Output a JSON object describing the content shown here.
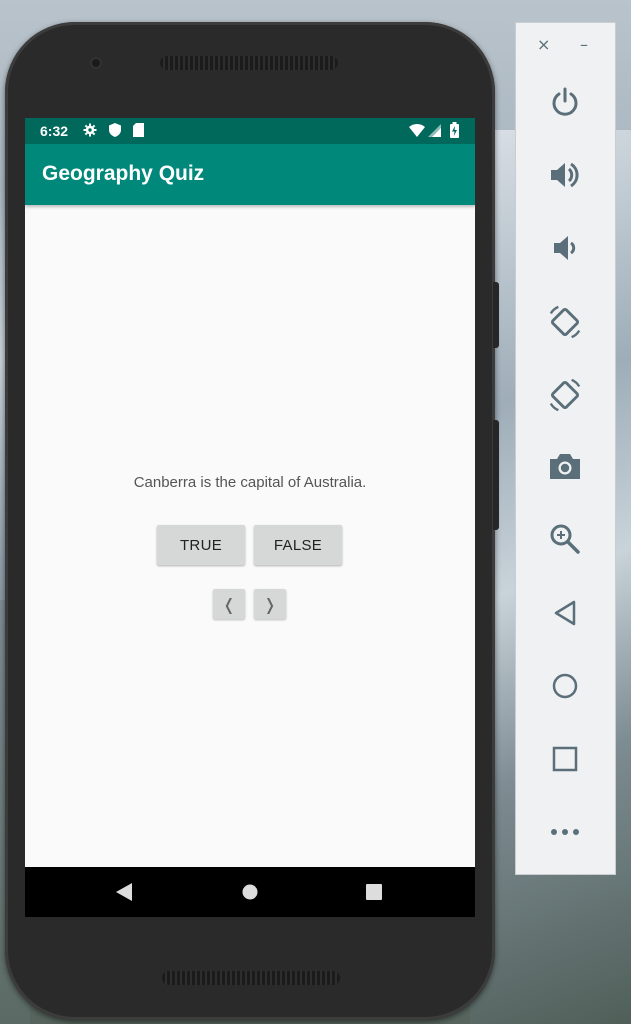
{
  "status_bar": {
    "time": "6:32",
    "left_icons": [
      "gear-icon",
      "shield-icon",
      "sd-card-icon"
    ],
    "right_icons": [
      "wifi-icon",
      "signal-icon",
      "battery-icon"
    ]
  },
  "app_bar": {
    "title": "Geography Quiz"
  },
  "quiz": {
    "question": "Canberra is the capital of Australia.",
    "true_label": "TRUE",
    "false_label": "FALSE",
    "prev_label": "❬",
    "next_label": "❭"
  },
  "system_nav": [
    "back-icon",
    "home-icon",
    "recents-icon"
  ],
  "emulator_panel": {
    "close_label": "×",
    "minimize_label": "–",
    "controls": [
      "power",
      "volume-up",
      "volume-down",
      "rotate-left",
      "rotate-right",
      "screenshot",
      "zoom",
      "back",
      "home",
      "overview",
      "more"
    ]
  },
  "colors": {
    "status_bar": "#00695c",
    "app_bar": "#00897b",
    "screen_bg": "#fafafa",
    "button_bg": "#d6d7d7",
    "panel_icon": "#5a6f7a"
  }
}
